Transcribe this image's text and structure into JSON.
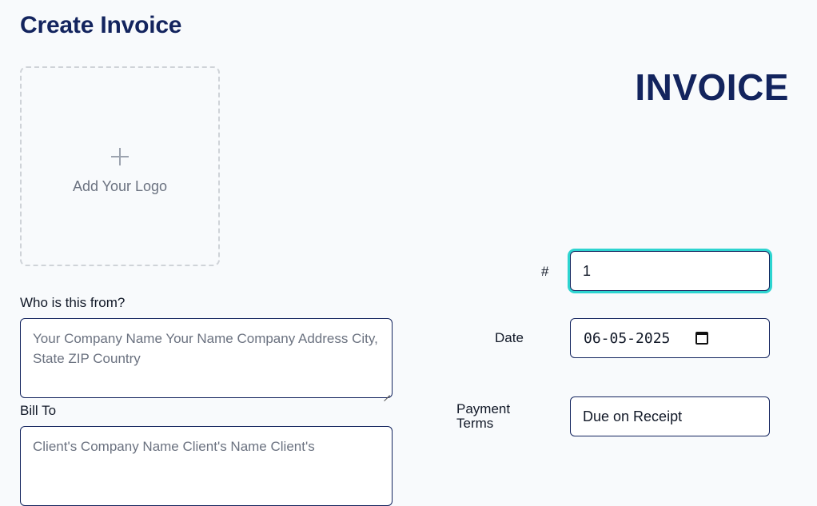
{
  "page": {
    "title": "Create Invoice"
  },
  "logo": {
    "label": "Add Your Logo",
    "icon": "plus-icon"
  },
  "invoice": {
    "heading": "INVOICE"
  },
  "from": {
    "label": "Who is this from?",
    "placeholder": "Your Company Name Your Name Company Address City, State ZIP Country",
    "value": ""
  },
  "bill_to": {
    "label": "Bill To",
    "placeholder": "Client's Company Name Client's Name Client's"
  },
  "number": {
    "label": "#",
    "value": "1"
  },
  "date": {
    "label": "Date",
    "value": "06-05-2025",
    "icon": "calendar-icon"
  },
  "payment_terms": {
    "label_line1": "Payment",
    "label_line2": "Terms",
    "value": "Due on Receipt"
  },
  "colors": {
    "heading": "#13245e",
    "focus_ring": "#2dd4d0",
    "border": "#13245e",
    "background": "#f8fafc"
  }
}
